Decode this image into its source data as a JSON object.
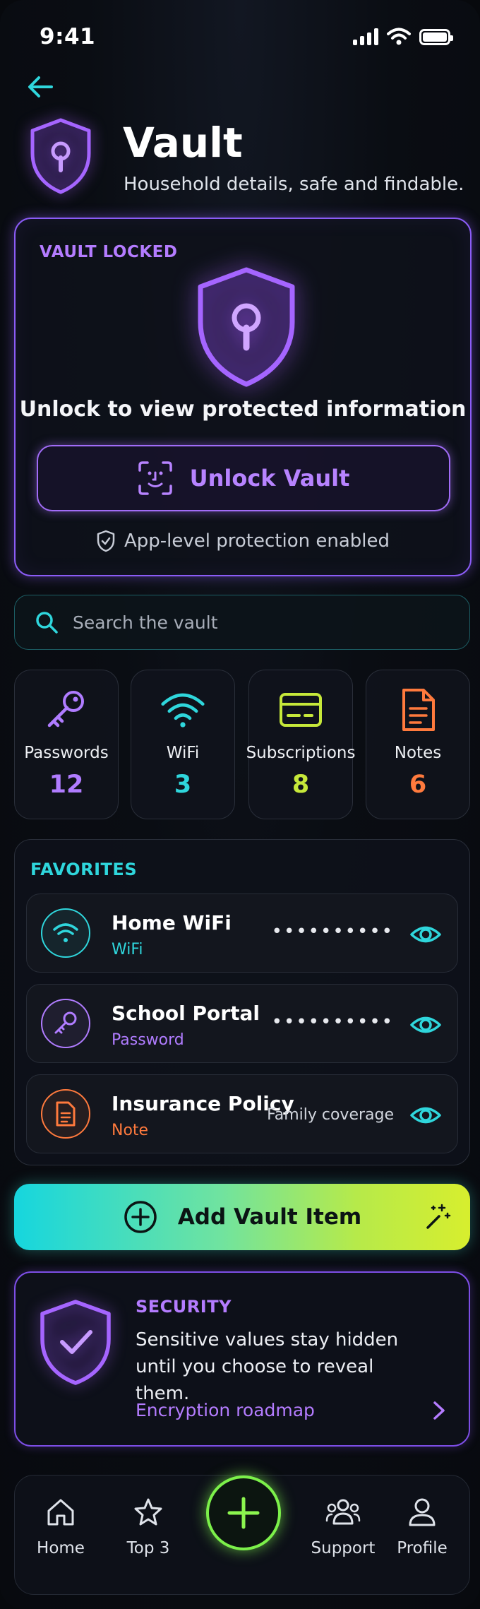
{
  "status_bar": {
    "time": "9:41"
  },
  "header": {
    "title": "Vault",
    "subtitle": "Household details, safe and findable."
  },
  "lock_card": {
    "label": "VAULT LOCKED",
    "message": "Unlock to view protected information",
    "unlock_label": "Unlock Vault",
    "protection_text": "App-level protection enabled"
  },
  "search": {
    "placeholder": "Search the vault"
  },
  "stats": [
    {
      "label": "Passwords",
      "count": "12",
      "color": "#b07cff",
      "icon": "key-icon"
    },
    {
      "label": "WiFi",
      "count": "3",
      "color": "#2fd6dc",
      "icon": "wifi-icon"
    },
    {
      "label": "Subscriptions",
      "count": "8",
      "color": "#c6e83a",
      "icon": "card-icon"
    },
    {
      "label": "Notes",
      "count": "6",
      "color": "#ff7a3d",
      "icon": "note-icon"
    }
  ],
  "favorites": {
    "title": "FAVORITES",
    "items": [
      {
        "name": "Home WiFi",
        "type": "WiFi",
        "value": "••••••••••",
        "icon": "wifi-icon",
        "color": "#2fd6dc"
      },
      {
        "name": "School Portal",
        "type": "Password",
        "value": "••••••••••",
        "icon": "key-icon",
        "color": "#b07cff"
      },
      {
        "name": "Insurance Policy",
        "type": "Note",
        "value": "Family coverage",
        "icon": "note-icon",
        "color": "#ff7a3d"
      }
    ]
  },
  "add_button": {
    "label": "Add Vault Item"
  },
  "security": {
    "title": "SECURITY",
    "text": "Sensitive values stay hidden until you choose to reveal them.",
    "link": "Encryption roadmap"
  },
  "nav": {
    "items": [
      {
        "label": "Home",
        "icon": "home-icon"
      },
      {
        "label": "Top 3",
        "icon": "star-icon"
      },
      {
        "label": "Support",
        "icon": "people-icon"
      },
      {
        "label": "Profile",
        "icon": "person-icon"
      }
    ]
  },
  "colors": {
    "accent_purple": "#a16cf7",
    "accent_teal": "#2fd6dc",
    "accent_green": "#7cf04a"
  }
}
